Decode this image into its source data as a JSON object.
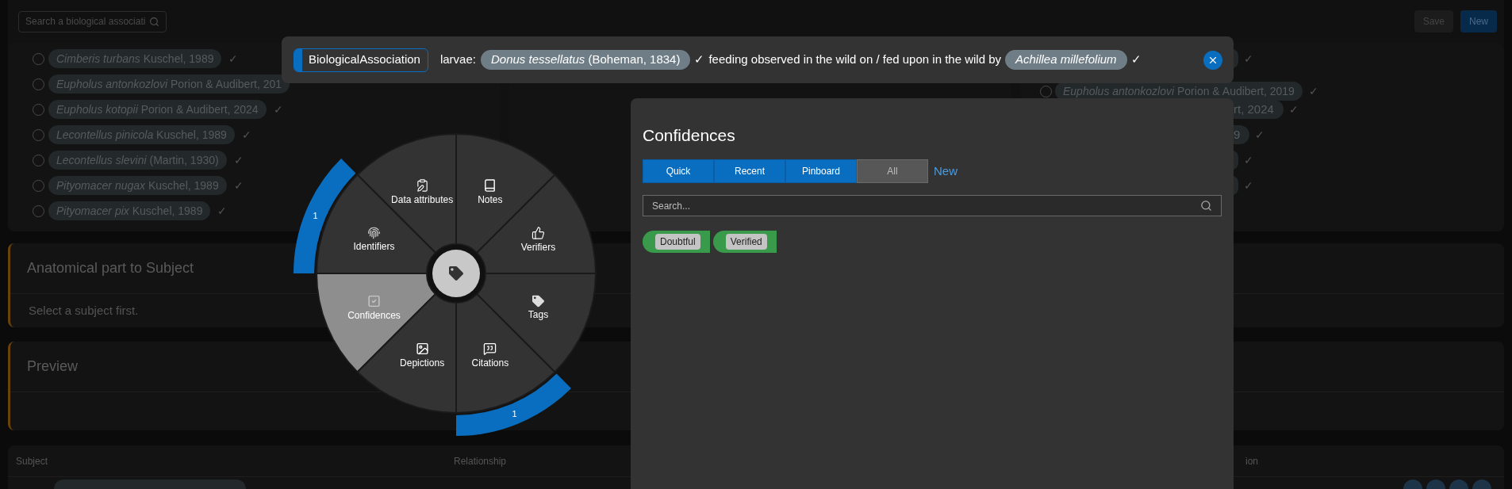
{
  "toolbar": {
    "search_placeholder": "Search a biological associati",
    "save": "Save",
    "new": "New"
  },
  "left_list": [
    {
      "name": "Cimberis turbans",
      "author": "Kuschel, 1989",
      "check": "✓",
      "selected": false
    },
    {
      "name": "Eupholus antonkozlovi",
      "author": "Porion & Audibert, 201",
      "selected": false
    },
    {
      "name": "Eupholus kotopii",
      "author": "Porion & Audibert, 2024",
      "check": "✓",
      "selected": false
    },
    {
      "name": "Lecontellus pinicola",
      "author": "Kuschel, 1989",
      "check": "✓",
      "selected": false
    },
    {
      "name": "Lecontellus slevini",
      "author": "(Martin, 1930)",
      "check": "✓",
      "selected": false
    },
    {
      "name": "Pityomacer nugax",
      "author": "Kuschel, 1989",
      "check": "✓",
      "selected": false
    },
    {
      "name": "Pityomacer pix",
      "author": "Kuschel, 1989",
      "check": "✓",
      "selected": false
    }
  ],
  "right_list": [
    {
      "kind": "cut",
      "check": "✓"
    },
    {
      "kind": "full",
      "name": "Eupholus antonkozlovi",
      "author": "Porion & Audibert, 2019",
      "check": "✓",
      "selected": false
    },
    {
      "kind": "cut",
      "text": "rt, 2024",
      "check": "✓"
    },
    {
      "kind": "cut",
      "text": "9",
      "check": "✓"
    },
    {
      "kind": "cut",
      "check": "✓"
    },
    {
      "kind": "cut",
      "check": "✓"
    }
  ],
  "anatomical_card": {
    "title": "Anatomical part to Subject",
    "message": "Select a subject first."
  },
  "preview_card": {
    "title": "Preview"
  },
  "table": {
    "columns": [
      "Subject",
      "Relationship",
      "ion"
    ]
  },
  "association_bar": {
    "badge": "BiologicalAssociation",
    "prefix": "larvae:",
    "subject": {
      "name": "Donus tessellatus",
      "author": "(Boheman, 1834)"
    },
    "subject_check": "✓",
    "relationship": "feeding observed in the wild on / fed upon in the wild by",
    "object": {
      "name": "Achillea millefolium"
    },
    "object_check": "✓"
  },
  "radial_menu": {
    "sectors": [
      {
        "kind": "attributes",
        "label": "Data attributes",
        "selected": false
      },
      {
        "kind": "notes",
        "label": "Notes",
        "selected": false
      },
      {
        "kind": "identifiers",
        "label": "Identifiers",
        "selected": false,
        "badge": "1"
      },
      {
        "kind": "verifiers",
        "label": "Verifiers",
        "selected": false
      },
      {
        "kind": "confidences",
        "label": "Confidences",
        "selected": true
      },
      {
        "kind": "tags",
        "label": "Tags",
        "selected": false
      },
      {
        "kind": "depictions",
        "label": "Depictions",
        "selected": false
      },
      {
        "kind": "citations",
        "label": "Citations",
        "selected": false,
        "badge": "1"
      }
    ]
  },
  "confidences_panel": {
    "title": "Confidences",
    "tabs": [
      {
        "label": "Quick",
        "selected": false
      },
      {
        "label": "Recent",
        "selected": false
      },
      {
        "label": "Pinboard",
        "selected": false
      },
      {
        "label": "All",
        "selected": true
      }
    ],
    "new_link": "New",
    "search_placeholder": "Search...",
    "items": [
      {
        "label": "Doubtful",
        "color": "#3a9a4b"
      },
      {
        "label": "Verified",
        "color": "#3a9a4b"
      }
    ]
  }
}
